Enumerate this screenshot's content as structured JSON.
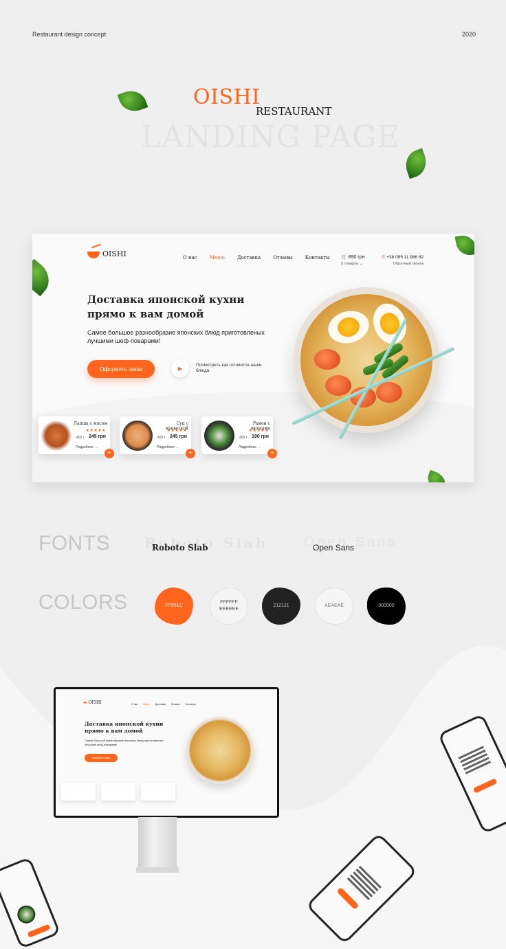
{
  "header": {
    "left_text": "Restaurant design concept",
    "right_text": "2020"
  },
  "brand": {
    "name": "OISHI",
    "tagline": "RESTAURANT",
    "subtitle": "LANDING PAGE"
  },
  "site": {
    "logo_text": "OISHI",
    "nav": [
      "О нас",
      "Меню",
      "Доставка",
      "Отзывы",
      "Контакты"
    ],
    "nav_active": "Меню",
    "cart": {
      "amount": "890 грн",
      "items": "5 товаров"
    },
    "contact": {
      "phone": "+38 095 11 986 82",
      "callback": "Обратный звонок"
    },
    "hero": {
      "title": "Доставка японской кухни прямо к вам домой",
      "subtitle": "Самое большое разнообразие японских блюд приготовленых лучшими шеф-поварами!",
      "cta": "Оформить заказ",
      "video_text": "Посмотреть как готовятся наши блюда"
    },
    "dishes": [
      {
        "name": "Лапша с мясом",
        "weight": "400 г",
        "price": "245 грн",
        "more": "Подробнее →",
        "stars": "★★★★★"
      },
      {
        "name": "Суп с креветкой",
        "weight": "400 г",
        "price": "245 грн",
        "more": "Подробнее →",
        "stars": "★★★★★"
      },
      {
        "name": "Рамен с овощами",
        "weight": "400 г",
        "price": "190 грн",
        "more": "Подробнее →",
        "stars": "★★★★★"
      }
    ],
    "add_symbol": "+"
  },
  "fonts": {
    "title": "FONTS",
    "font1_ghost": "Roboto Slab",
    "font1": "Roboto Slab",
    "font2_ghost": "Open Sans",
    "font2": "Open Sans"
  },
  "colors": {
    "title": "COLORS",
    "swatches": [
      {
        "label": "FF651C",
        "hex": "#FF651C",
        "text": "#ffffff"
      },
      {
        "label": "FFFFFF\nEEEEEE",
        "hex": "#F4F4F4",
        "text": "#555555"
      },
      {
        "label": "212121",
        "hex": "#212121",
        "text": "#bbbbbb"
      },
      {
        "label": "AEAEAE",
        "hex": "#F6F6F6",
        "text": "#777777"
      },
      {
        "label": "000000",
        "hex": "#000000",
        "text": "#bbbbbb"
      }
    ]
  },
  "icons": {
    "cart": "cart-icon",
    "phone": "phone-icon",
    "play": "play-icon",
    "leaf": "basil-leaf-icon"
  }
}
